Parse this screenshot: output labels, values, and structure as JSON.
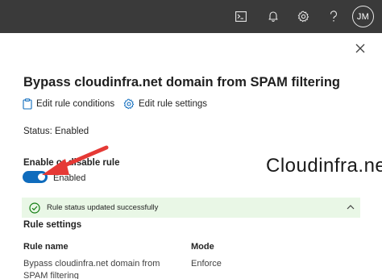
{
  "topbar": {
    "icons": [
      "terminal-icon",
      "bell-icon",
      "gear-icon",
      "help-icon"
    ],
    "avatar_initials": "JM",
    "background": "#3a3a3a"
  },
  "panel": {
    "title": "Bypass cloudinfra.net domain from SPAM filtering",
    "commands": [
      {
        "label": "Edit rule conditions",
        "icon": "clipboard-icon"
      },
      {
        "label": "Edit rule settings",
        "icon": "gear-icon"
      }
    ],
    "status_text": "Status: Enabled",
    "toggle": {
      "label": "Enable or disable rule",
      "state_text": "Enabled",
      "on": true,
      "color": "#0f6cbd"
    },
    "message_bar": {
      "text": "Rule status updated successfully",
      "background": "#e9f7e6",
      "icon": "checkmark-circle-icon"
    },
    "rule_settings": {
      "title": "Rule settings",
      "columns": [
        "Rule name",
        "Mode"
      ],
      "rows": [
        {
          "name": "Bypass cloudinfra.net domain from SPAM filtering",
          "mode": "Enforce"
        }
      ]
    }
  },
  "watermark": "Cloudinfra.net",
  "annotation_arrow_color": "#e53935"
}
